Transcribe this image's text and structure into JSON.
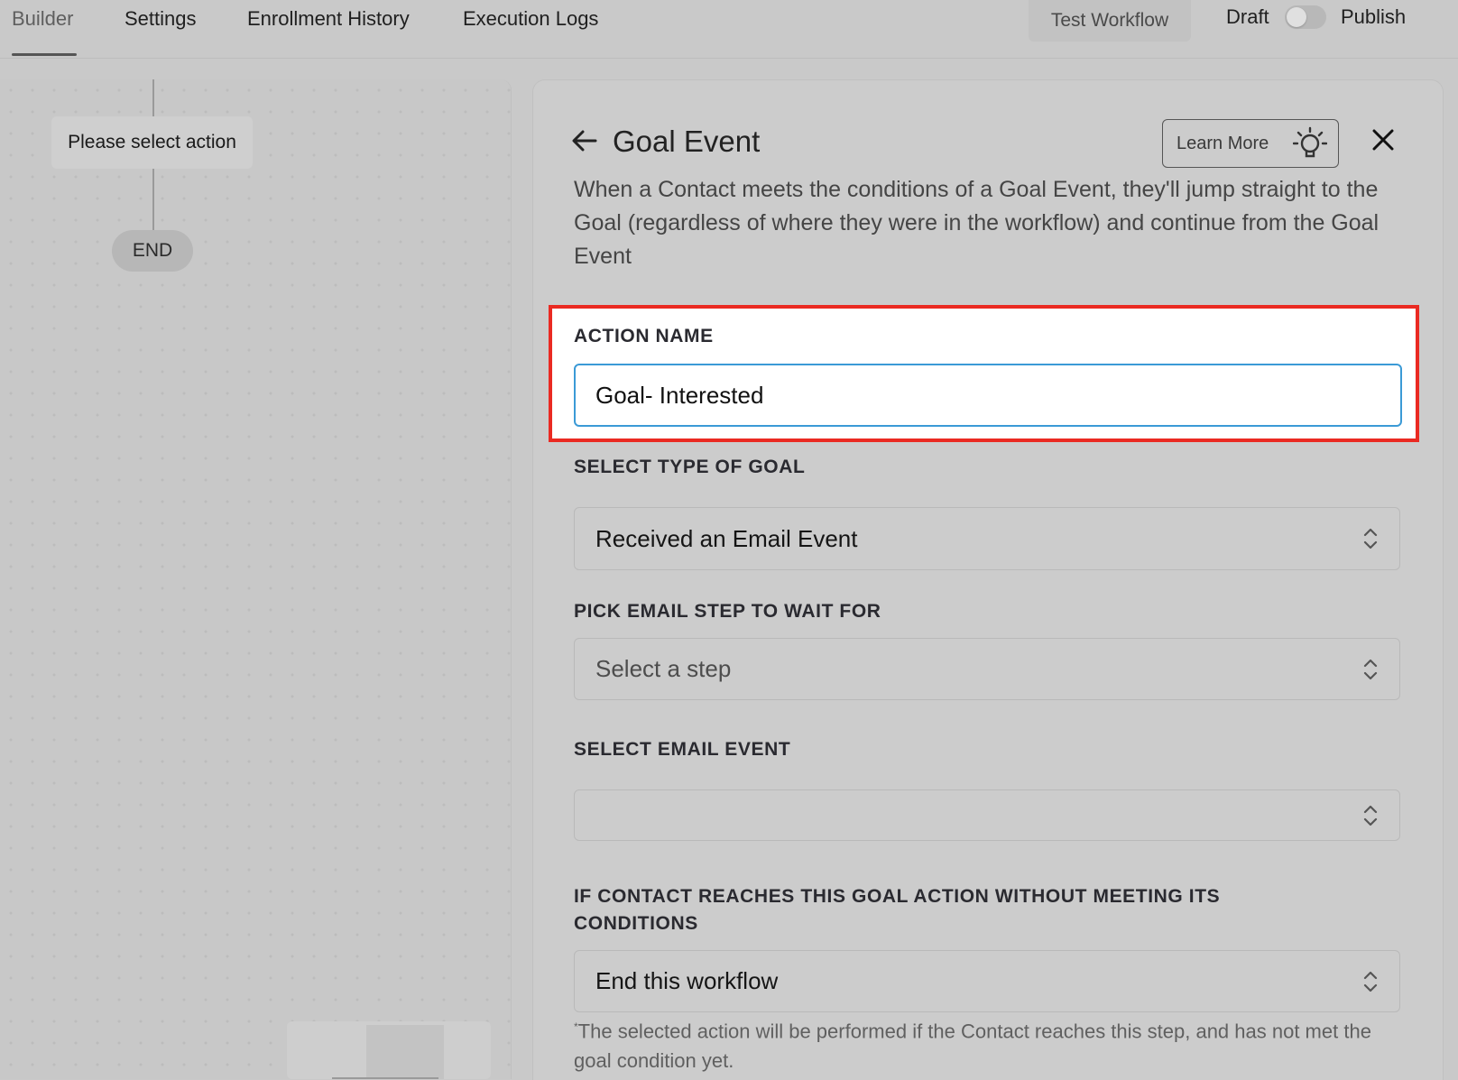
{
  "nav": {
    "tabs": [
      {
        "label": "Builder",
        "active": true
      },
      {
        "label": "Settings"
      },
      {
        "label": "Enrollment History"
      },
      {
        "label": "Execution Logs"
      }
    ],
    "test_workflow_label": "Test Workflow",
    "draft_label": "Draft",
    "publish_label": "Publish",
    "publish_toggle_on": false
  },
  "canvas": {
    "action_node_label": "Please select action",
    "end_node_label": "END"
  },
  "panel": {
    "title": "Goal Event",
    "learn_more_label": "Learn More",
    "description": "When a Contact meets the conditions of a Goal Event, they'll jump straight to the Goal (regardless of where they were in the workflow) and continue from the Goal Event",
    "action_name": {
      "label": "ACTION NAME",
      "value": "Goal- Interested"
    },
    "goal_type": {
      "label": "SELECT TYPE OF GOAL",
      "value": "Received an Email Event"
    },
    "email_step": {
      "label": "PICK EMAIL STEP TO WAIT FOR",
      "placeholder": "Select a step"
    },
    "email_event": {
      "label": "SELECT EMAIL EVENT",
      "value": ""
    },
    "fallback": {
      "label_line1": "IF CONTACT REACHES THIS GOAL ACTION WITHOUT MEETING ITS",
      "label_line2": "CONDITIONS",
      "value": "End this workflow"
    },
    "footnote_mark": "*",
    "footnote": "The selected action will be performed if the Contact reaches this step, and has not met the goal condition yet."
  },
  "colors": {
    "highlight_border": "#ea2a22",
    "input_focus_border": "#3b9ad6"
  }
}
